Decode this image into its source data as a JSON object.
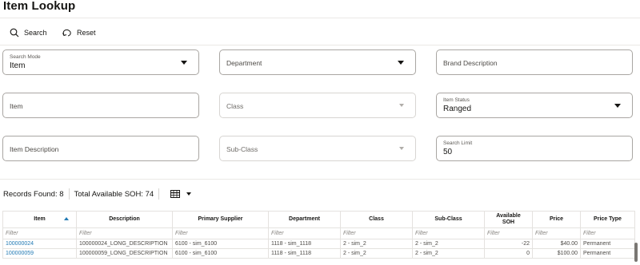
{
  "page": {
    "title": "Item Lookup"
  },
  "toolbar": {
    "search_label": "Search",
    "reset_label": "Reset"
  },
  "form": {
    "search_mode": {
      "label": "Search Mode",
      "value": "Item"
    },
    "department": {
      "placeholder": "Department"
    },
    "brand_description": {
      "placeholder": "Brand Description"
    },
    "item": {
      "placeholder": "Item"
    },
    "class": {
      "placeholder": "Class"
    },
    "item_status": {
      "label": "Item Status",
      "value": "Ranged"
    },
    "item_description": {
      "placeholder": "Item Description"
    },
    "sub_class": {
      "placeholder": "Sub-Class"
    },
    "search_limit": {
      "label": "Search Limit",
      "value": "50"
    }
  },
  "summary": {
    "records_found": "Records Found: 8",
    "total_soh": "Total Available SOH: 74"
  },
  "table": {
    "headers": [
      "Item",
      "Description",
      "Primary Supplier",
      "Department",
      "Class",
      "Sub-Class",
      "Available SOH",
      "Price",
      "Price Type"
    ],
    "filter_placeholder": "Filter",
    "sorted_column": "Item",
    "rows": [
      [
        "100000024",
        "100000024_LONG_DESCRIPTION",
        "6100 - sim_6100",
        "1118 - sim_1118",
        "2 - sim_2",
        "2 - sim_2",
        "-22",
        "$40.00",
        "Permanent"
      ],
      [
        "100000059",
        "100000059_LONG_DESCRIPTION",
        "6100 - sim_6100",
        "1118 - sim_1118",
        "2 - sim_2",
        "2 - sim_2",
        "0",
        "$100.00",
        "Permanent"
      ]
    ]
  },
  "icons": {
    "search": "search-icon",
    "reset": "reset-icon",
    "grid": "grid-icon"
  },
  "colors": {
    "link": "#227ab4",
    "border": "#a9a6a2"
  }
}
